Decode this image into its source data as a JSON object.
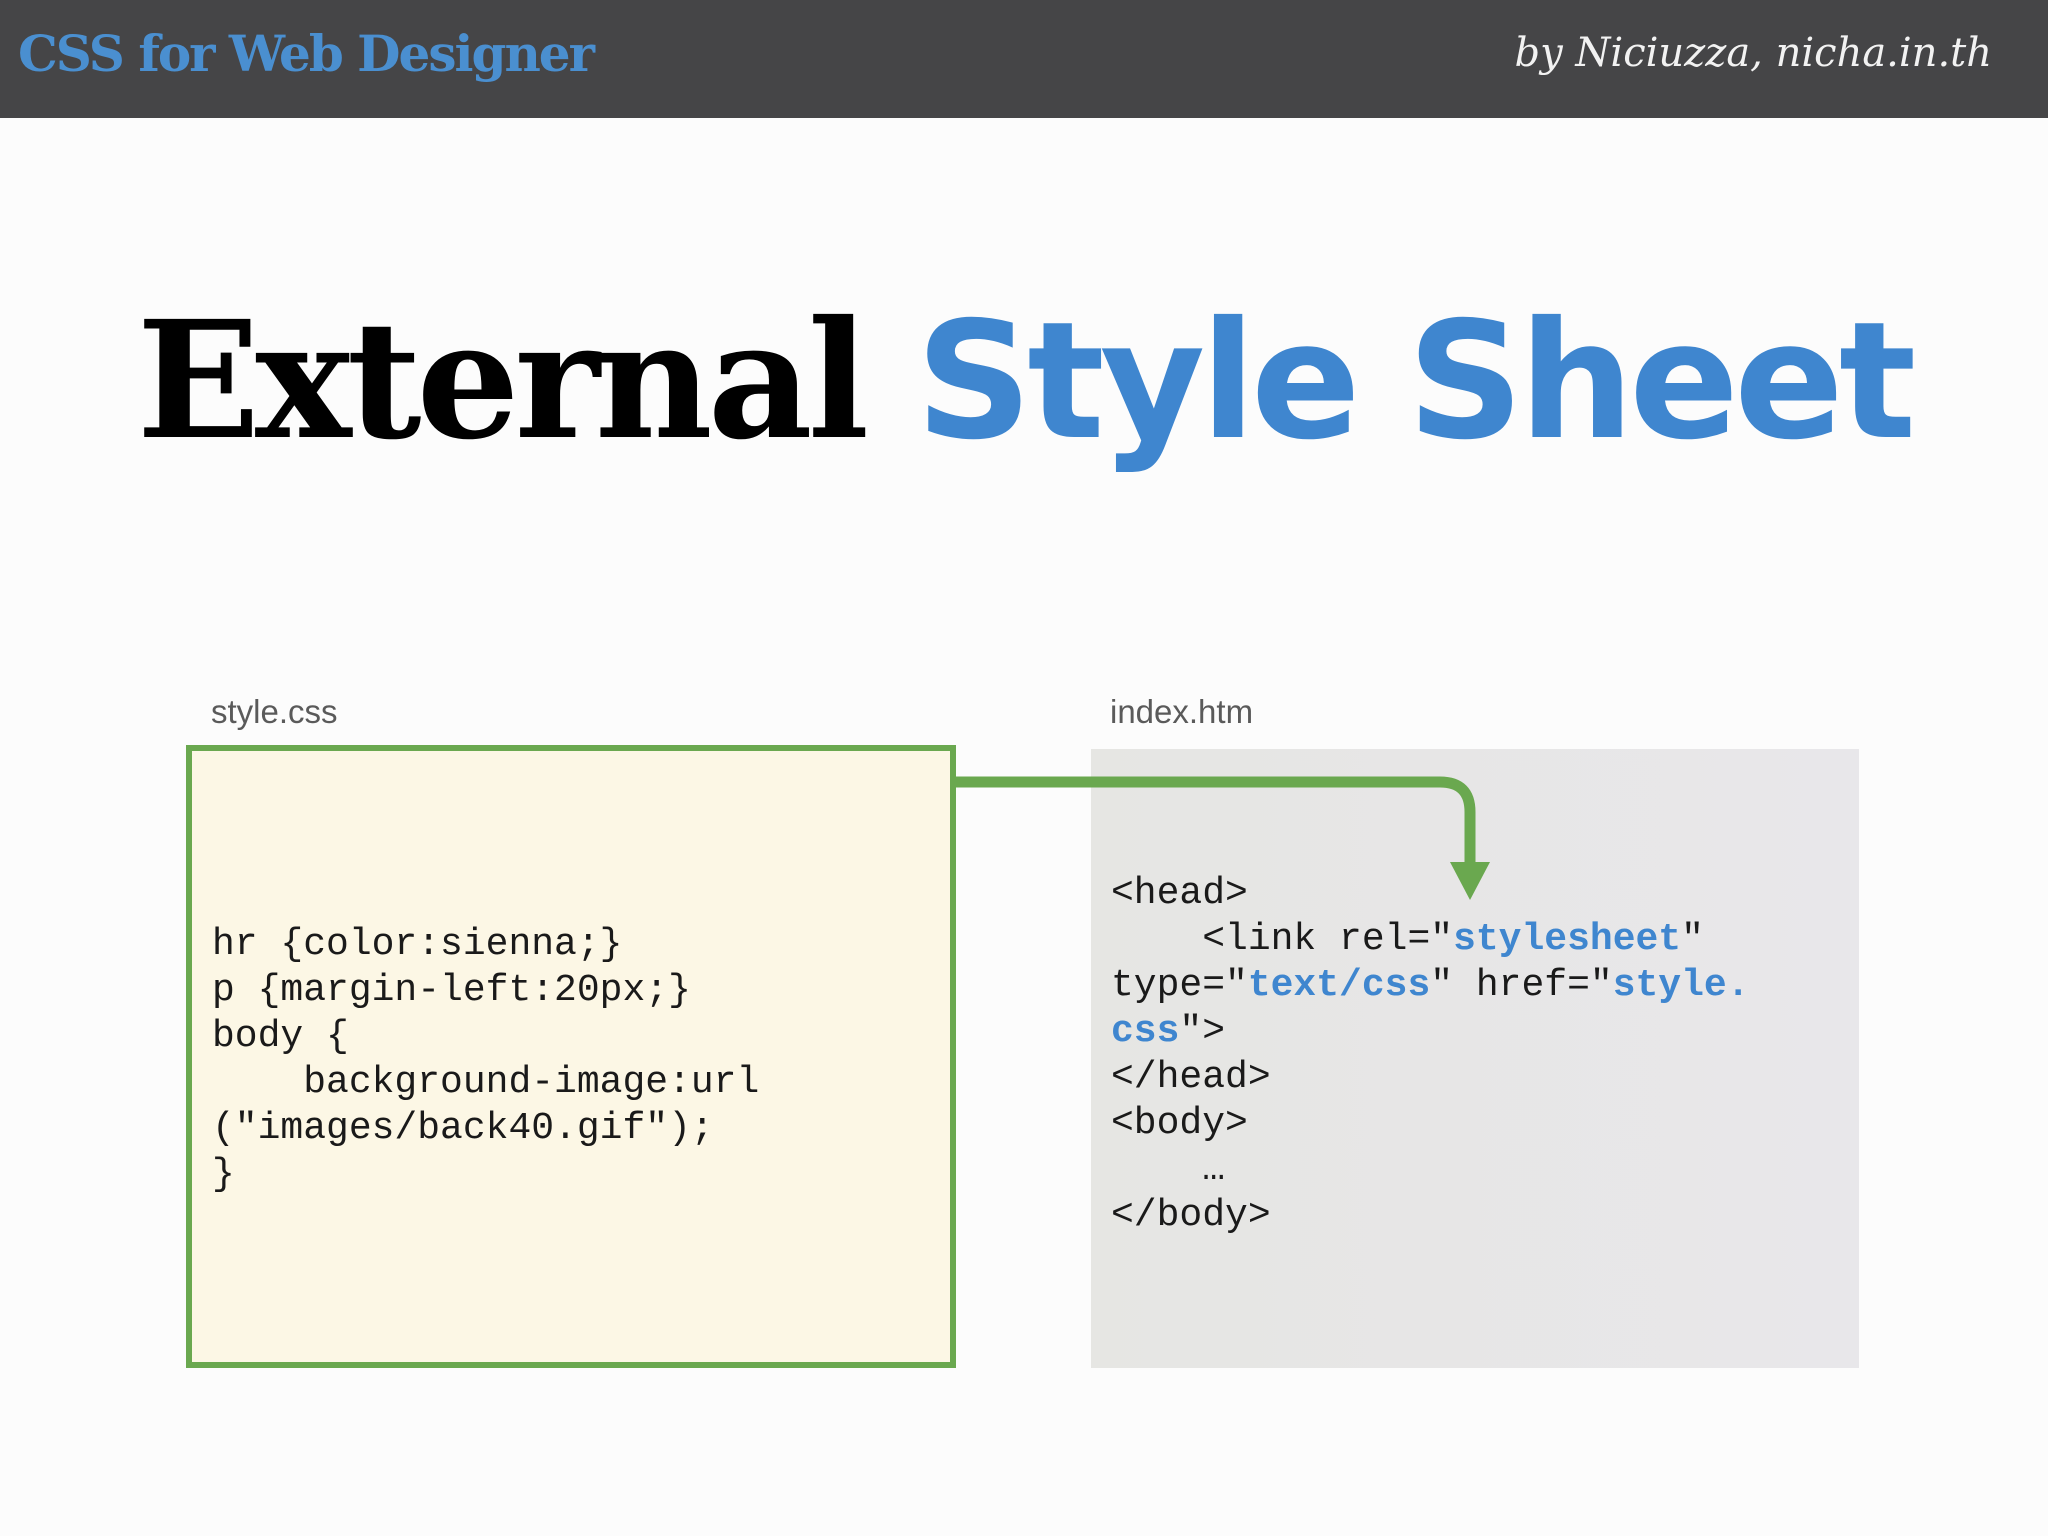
{
  "header": {
    "left_title": "CSS for Web Designer",
    "right_credit": "by  Niciuzza,  nicha.in.th"
  },
  "slide": {
    "title_black": "External",
    "title_blue": "Style Sheet"
  },
  "files": {
    "css_label": "style.css",
    "htm_label": "index.htm"
  },
  "css_code": {
    "line1": "hr {color:sienna;}",
    "line2": "p {margin-left:20px;}",
    "line3": "body {",
    "line4": "    background-image:url",
    "line5": "(\"images/back40.gif\");",
    "line6": "}"
  },
  "htm_code": {
    "head_open": "<head>",
    "link_pre": "    <link rel=\"",
    "rel_value": "stylesheet",
    "link_post": "\"",
    "type_pre": "type=\"",
    "type_value": "text/css",
    "href_pre": "\" href=\"",
    "href_value_1": "style.",
    "href_value_2": "css",
    "link_close": "\">",
    "head_close": "</head>",
    "body_open": "<body>",
    "ellipsis": "    …",
    "body_close": "</body>"
  },
  "colors": {
    "header_bg": "#454547",
    "accent_blue": "#3f86cf",
    "box_green": "#6aa84f",
    "css_box_bg": "#fcf7e5",
    "htm_box_bg": "#e7e7e8"
  }
}
